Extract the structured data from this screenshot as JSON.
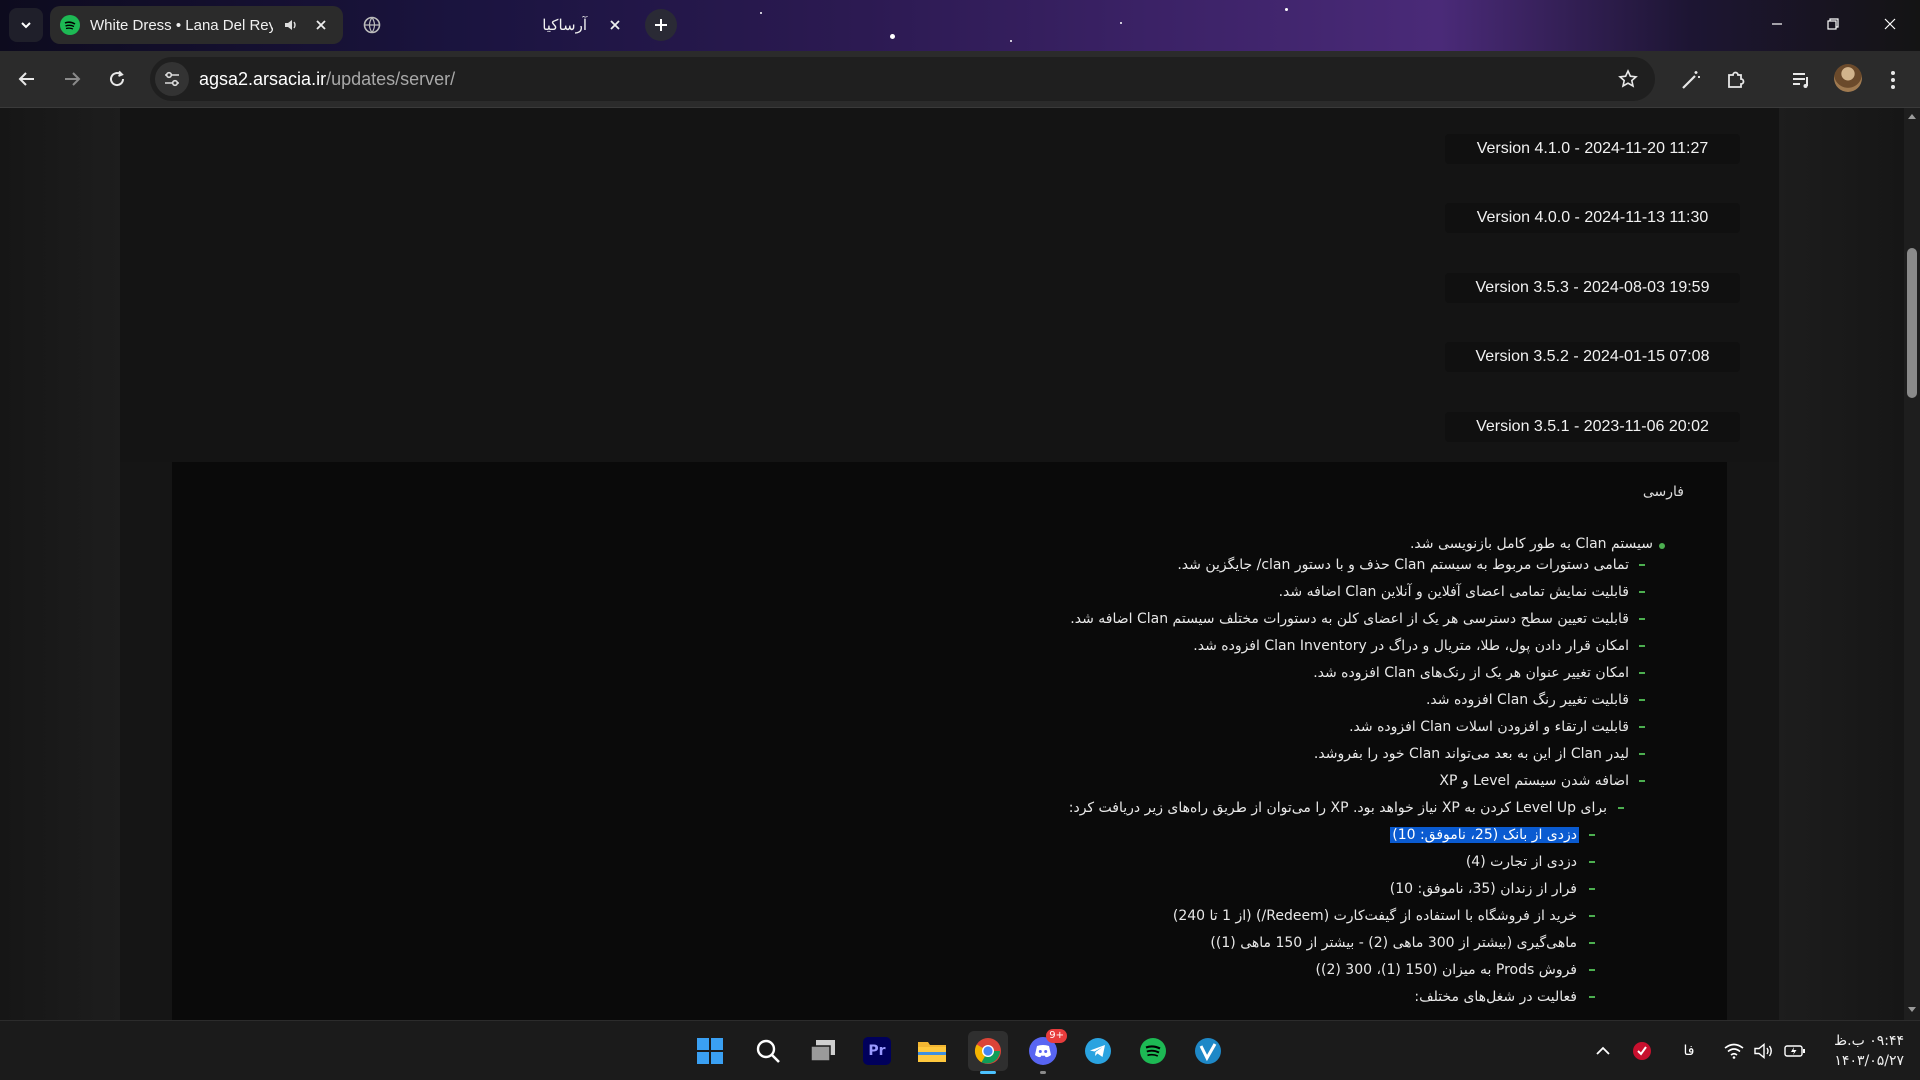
{
  "browser": {
    "tabs": [
      {
        "title": "White Dress • Lana Del Rey",
        "active": true,
        "favicon": "spotify-icon",
        "audio": true
      },
      {
        "title": "آرساکیا",
        "active": false,
        "favicon": "globe-icon"
      }
    ],
    "url_host": "agsa2.arsacia.ir",
    "url_path": "/updates/server/"
  },
  "versions": [
    "Version 4.1.0 - 2024-11-20 11:27",
    "Version 4.0.0 - 2024-11-13 11:30",
    "Version 3.5.3 - 2024-08-03 19:59",
    "Version 3.5.2 - 2024-01-15 07:08",
    "Version 3.5.1 - 2023-11-06 20:02"
  ],
  "changelog": {
    "language": "فارسی",
    "items": [
      "سیستم Clan به طور کامل بازنویسی شد.",
      "تمامی دستورات مربوط به سیستم Clan حذف و با دستور clan/ جایگزین شد.",
      "قابلیت نمایش تمامی اعضای آفلاین و آنلاین Clan اضافه شد.",
      "قابلیت تعیین سطح دسترسی هر یک از اعضای کلن به دستورات مختلف سیستم Clan اضافه شد.",
      "امکان قرار دادن پول، طلا، متریال و دراگ در Clan Inventory افزوده شد.",
      "امکان تغییر عنوان هر یک از رنک‌های Clan افزوده شد.",
      "قابلیت تغییر رنگ Clan افزوده شد.",
      "قابلیت ارتقاء و افزودن اسلات Clan افزوده شد.",
      "لیدر Clan از این به بعد می‌تواند Clan خود را بفروشد.",
      "اضافه شدن سیستم Level و XP",
      "برای Level Up کردن به XP نیاز خواهد بود. XP را می‌توان از طریق راه‌های زیر دریافت کرد:",
      "دزدی از بانک (25، ناموفق: 10)",
      "دزدی از تجارت (4)",
      "فرار از زندان (35، ناموفق: 10)",
      "خرید از فروشگاه با استفاده از گیفت‌کارت (Redeem/) (از 1 تا 240)",
      "ماهی‌گیری (بیشتر از 300 ماهی (2) - بیشتر از 150 ماهی (1))",
      "فروش Prods به میزان (150 (1)، 300 (2))",
      "فعالیت در شغل‌های مختلف:"
    ]
  },
  "taskbar": {
    "apps": [
      "windows-start-icon",
      "search-icon",
      "task-view-icon",
      "premiere-pro-icon",
      "file-explorer-icon",
      "chrome-icon",
      "discord-icon",
      "telegram-icon",
      "spotify-icon",
      "vpn-icon"
    ],
    "discord_badge": "9+",
    "language": "فا",
    "time": "۰۹:۴۴ ب.ظ",
    "date": "۱۴۰۳/۰۵/۲۷"
  },
  "colors": {
    "accent_green": "#4caf50",
    "selection_blue": "#0a5bd1",
    "chrome_blue": "#4cc2ff"
  }
}
